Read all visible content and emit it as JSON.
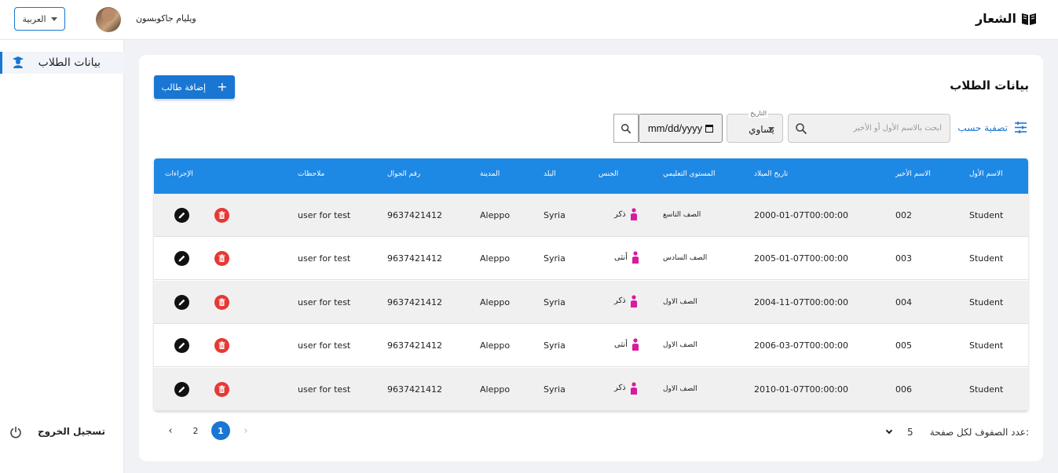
{
  "header": {
    "logo_text": "الشعار",
    "language": "العربية",
    "user_name": "ويليام جاكوبسون"
  },
  "sidebar": {
    "items": [
      {
        "label": "بيانات الطلاب",
        "icon": "student-icon"
      }
    ],
    "logout_label": "تسجيل الخروج"
  },
  "page": {
    "title": "بيانات الطلاب",
    "add_button": "إضافة طالب"
  },
  "filters": {
    "filter_label": "تصفية حسب",
    "search_placeholder": "ابحث بالاسم الأول أو الأخير",
    "date_label": "التاريخ",
    "operator_value": "يساوي",
    "date_value": "mm/dd/yyyy"
  },
  "table": {
    "headers": {
      "first_name": "الاسم الأول",
      "last_name": "الاسم الأخير",
      "birth_date": "تاريخ الميلاد",
      "level": "المستوى التعليمي",
      "gender": "الجنس",
      "country": "البلد",
      "city": "المدينة",
      "phone": "رقم الجوال",
      "notes": "ملاحظات",
      "actions": "الإجراءات"
    },
    "rows": [
      {
        "first_name": "Student",
        "last_name": "002",
        "birth_date": "2000-01-07T00:00:00",
        "level": "الصف التاسع",
        "gender": "ذكر",
        "country": "Syria",
        "city": "Aleppo",
        "phone": "9637421412",
        "notes": "user for test"
      },
      {
        "first_name": "Student",
        "last_name": "003",
        "birth_date": "2005-01-07T00:00:00",
        "level": "الصف السادس",
        "gender": "أنثى",
        "country": "Syria",
        "city": "Aleppo",
        "phone": "9637421412",
        "notes": "user for test"
      },
      {
        "first_name": "Student",
        "last_name": "004",
        "birth_date": "2004-11-07T00:00:00",
        "level": "الصف الاول",
        "gender": "ذكر",
        "country": "Syria",
        "city": "Aleppo",
        "phone": "9637421412",
        "notes": "user for test"
      },
      {
        "first_name": "Student",
        "last_name": "005",
        "birth_date": "2006-03-07T00:00:00",
        "level": "الصف الاول",
        "gender": "أنثى",
        "country": "Syria",
        "city": "Aleppo",
        "phone": "9637421412",
        "notes": "user for test"
      },
      {
        "first_name": "Student",
        "last_name": "006",
        "birth_date": "2010-01-07T00:00:00",
        "level": "الصف الاول",
        "gender": "ذكر",
        "country": "Syria",
        "city": "Aleppo",
        "phone": "9637421412",
        "notes": "user for test"
      }
    ]
  },
  "pagination": {
    "rows_per_page_label": "عدد الصفوف لكل صفحة:",
    "rows_per_page_value": "5",
    "pages": [
      "1",
      "2"
    ],
    "current_page": "1",
    "prev_icon": "chevron-left-icon",
    "next_icon": "chevron-right-icon"
  },
  "colors": {
    "primary": "#1976d2",
    "table_header": "#1e88e5",
    "delete": "#e53935",
    "gender_icon": "#d81b9f"
  }
}
